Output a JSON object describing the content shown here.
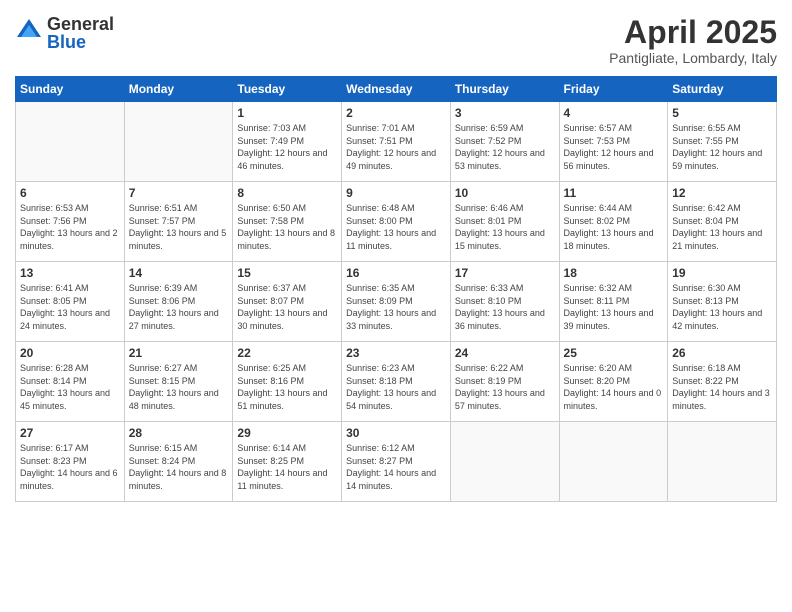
{
  "logo": {
    "general": "General",
    "blue": "Blue"
  },
  "title": "April 2025",
  "location": "Pantigliate, Lombardy, Italy",
  "weekdays": [
    "Sunday",
    "Monday",
    "Tuesday",
    "Wednesday",
    "Thursday",
    "Friday",
    "Saturday"
  ],
  "weeks": [
    [
      {
        "day": "",
        "info": ""
      },
      {
        "day": "",
        "info": ""
      },
      {
        "day": "1",
        "info": "Sunrise: 7:03 AM\nSunset: 7:49 PM\nDaylight: 12 hours\nand 46 minutes."
      },
      {
        "day": "2",
        "info": "Sunrise: 7:01 AM\nSunset: 7:51 PM\nDaylight: 12 hours\nand 49 minutes."
      },
      {
        "day": "3",
        "info": "Sunrise: 6:59 AM\nSunset: 7:52 PM\nDaylight: 12 hours\nand 53 minutes."
      },
      {
        "day": "4",
        "info": "Sunrise: 6:57 AM\nSunset: 7:53 PM\nDaylight: 12 hours\nand 56 minutes."
      },
      {
        "day": "5",
        "info": "Sunrise: 6:55 AM\nSunset: 7:55 PM\nDaylight: 12 hours\nand 59 minutes."
      }
    ],
    [
      {
        "day": "6",
        "info": "Sunrise: 6:53 AM\nSunset: 7:56 PM\nDaylight: 13 hours\nand 2 minutes."
      },
      {
        "day": "7",
        "info": "Sunrise: 6:51 AM\nSunset: 7:57 PM\nDaylight: 13 hours\nand 5 minutes."
      },
      {
        "day": "8",
        "info": "Sunrise: 6:50 AM\nSunset: 7:58 PM\nDaylight: 13 hours\nand 8 minutes."
      },
      {
        "day": "9",
        "info": "Sunrise: 6:48 AM\nSunset: 8:00 PM\nDaylight: 13 hours\nand 11 minutes."
      },
      {
        "day": "10",
        "info": "Sunrise: 6:46 AM\nSunset: 8:01 PM\nDaylight: 13 hours\nand 15 minutes."
      },
      {
        "day": "11",
        "info": "Sunrise: 6:44 AM\nSunset: 8:02 PM\nDaylight: 13 hours\nand 18 minutes."
      },
      {
        "day": "12",
        "info": "Sunrise: 6:42 AM\nSunset: 8:04 PM\nDaylight: 13 hours\nand 21 minutes."
      }
    ],
    [
      {
        "day": "13",
        "info": "Sunrise: 6:41 AM\nSunset: 8:05 PM\nDaylight: 13 hours\nand 24 minutes."
      },
      {
        "day": "14",
        "info": "Sunrise: 6:39 AM\nSunset: 8:06 PM\nDaylight: 13 hours\nand 27 minutes."
      },
      {
        "day": "15",
        "info": "Sunrise: 6:37 AM\nSunset: 8:07 PM\nDaylight: 13 hours\nand 30 minutes."
      },
      {
        "day": "16",
        "info": "Sunrise: 6:35 AM\nSunset: 8:09 PM\nDaylight: 13 hours\nand 33 minutes."
      },
      {
        "day": "17",
        "info": "Sunrise: 6:33 AM\nSunset: 8:10 PM\nDaylight: 13 hours\nand 36 minutes."
      },
      {
        "day": "18",
        "info": "Sunrise: 6:32 AM\nSunset: 8:11 PM\nDaylight: 13 hours\nand 39 minutes."
      },
      {
        "day": "19",
        "info": "Sunrise: 6:30 AM\nSunset: 8:13 PM\nDaylight: 13 hours\nand 42 minutes."
      }
    ],
    [
      {
        "day": "20",
        "info": "Sunrise: 6:28 AM\nSunset: 8:14 PM\nDaylight: 13 hours\nand 45 minutes."
      },
      {
        "day": "21",
        "info": "Sunrise: 6:27 AM\nSunset: 8:15 PM\nDaylight: 13 hours\nand 48 minutes."
      },
      {
        "day": "22",
        "info": "Sunrise: 6:25 AM\nSunset: 8:16 PM\nDaylight: 13 hours\nand 51 minutes."
      },
      {
        "day": "23",
        "info": "Sunrise: 6:23 AM\nSunset: 8:18 PM\nDaylight: 13 hours\nand 54 minutes."
      },
      {
        "day": "24",
        "info": "Sunrise: 6:22 AM\nSunset: 8:19 PM\nDaylight: 13 hours\nand 57 minutes."
      },
      {
        "day": "25",
        "info": "Sunrise: 6:20 AM\nSunset: 8:20 PM\nDaylight: 14 hours\nand 0 minutes."
      },
      {
        "day": "26",
        "info": "Sunrise: 6:18 AM\nSunset: 8:22 PM\nDaylight: 14 hours\nand 3 minutes."
      }
    ],
    [
      {
        "day": "27",
        "info": "Sunrise: 6:17 AM\nSunset: 8:23 PM\nDaylight: 14 hours\nand 6 minutes."
      },
      {
        "day": "28",
        "info": "Sunrise: 6:15 AM\nSunset: 8:24 PM\nDaylight: 14 hours\nand 8 minutes."
      },
      {
        "day": "29",
        "info": "Sunrise: 6:14 AM\nSunset: 8:25 PM\nDaylight: 14 hours\nand 11 minutes."
      },
      {
        "day": "30",
        "info": "Sunrise: 6:12 AM\nSunset: 8:27 PM\nDaylight: 14 hours\nand 14 minutes."
      },
      {
        "day": "",
        "info": ""
      },
      {
        "day": "",
        "info": ""
      },
      {
        "day": "",
        "info": ""
      }
    ]
  ]
}
